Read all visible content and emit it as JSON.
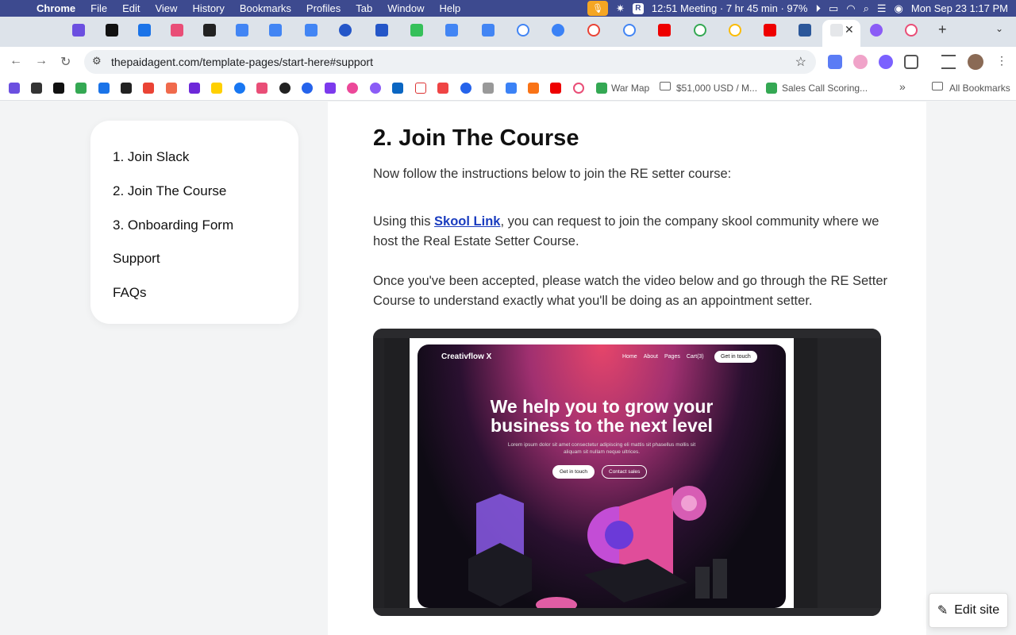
{
  "menubar": {
    "app": "Chrome",
    "items": [
      "File",
      "Edit",
      "View",
      "History",
      "Bookmarks",
      "Profiles",
      "Tab",
      "Window",
      "Help"
    ],
    "meeting": "12:51 Meeting · 7 hr 45 min · 97%",
    "datetime": "Mon Sep 23  1:17 PM"
  },
  "toolbar": {
    "url": "thepaidagent.com/template-pages/start-here#support"
  },
  "bookmarks": {
    "war_map": "War Map",
    "revenue": "$51,000 USD / M...",
    "sales_call": "Sales Call Scoring...",
    "all": "All Bookmarks"
  },
  "sidebar": {
    "items": [
      "1. Join Slack",
      "2. Join The Course",
      "3. Onboarding Form",
      "Support",
      "FAQs"
    ]
  },
  "main": {
    "heading": "2. Join The Course",
    "intro": "Now follow the instructions below to join the RE setter course:",
    "p1_before": "Using this ",
    "p1_link": "Skool Link",
    "p1_after": ", you can request to join the company skool community where we host the Real Estate Setter Course.",
    "p2": "Once you've been accepted, please watch the video below and go through the RE Setter Course to understand exactly what you'll be doing as an appointment setter."
  },
  "video": {
    "logo": "Creativflow X",
    "nav": [
      "Home",
      "About",
      "Pages",
      "Cart(3)"
    ],
    "cta_top": "Get in touch",
    "title": "We help you to grow your business to the next level",
    "subtitle": "Lorem ipsum dolor sit amet consectetur adipiscing eli mattis sit phasellus mollis sit aliquam sit nullam neque ultrices.",
    "btn_primary": "Get in touch",
    "btn_secondary": "Contact sales"
  },
  "edit_site": {
    "label": "Edit site"
  },
  "colors": {
    "menubar": "#3d4a8f",
    "link": "#1a3cbf"
  }
}
